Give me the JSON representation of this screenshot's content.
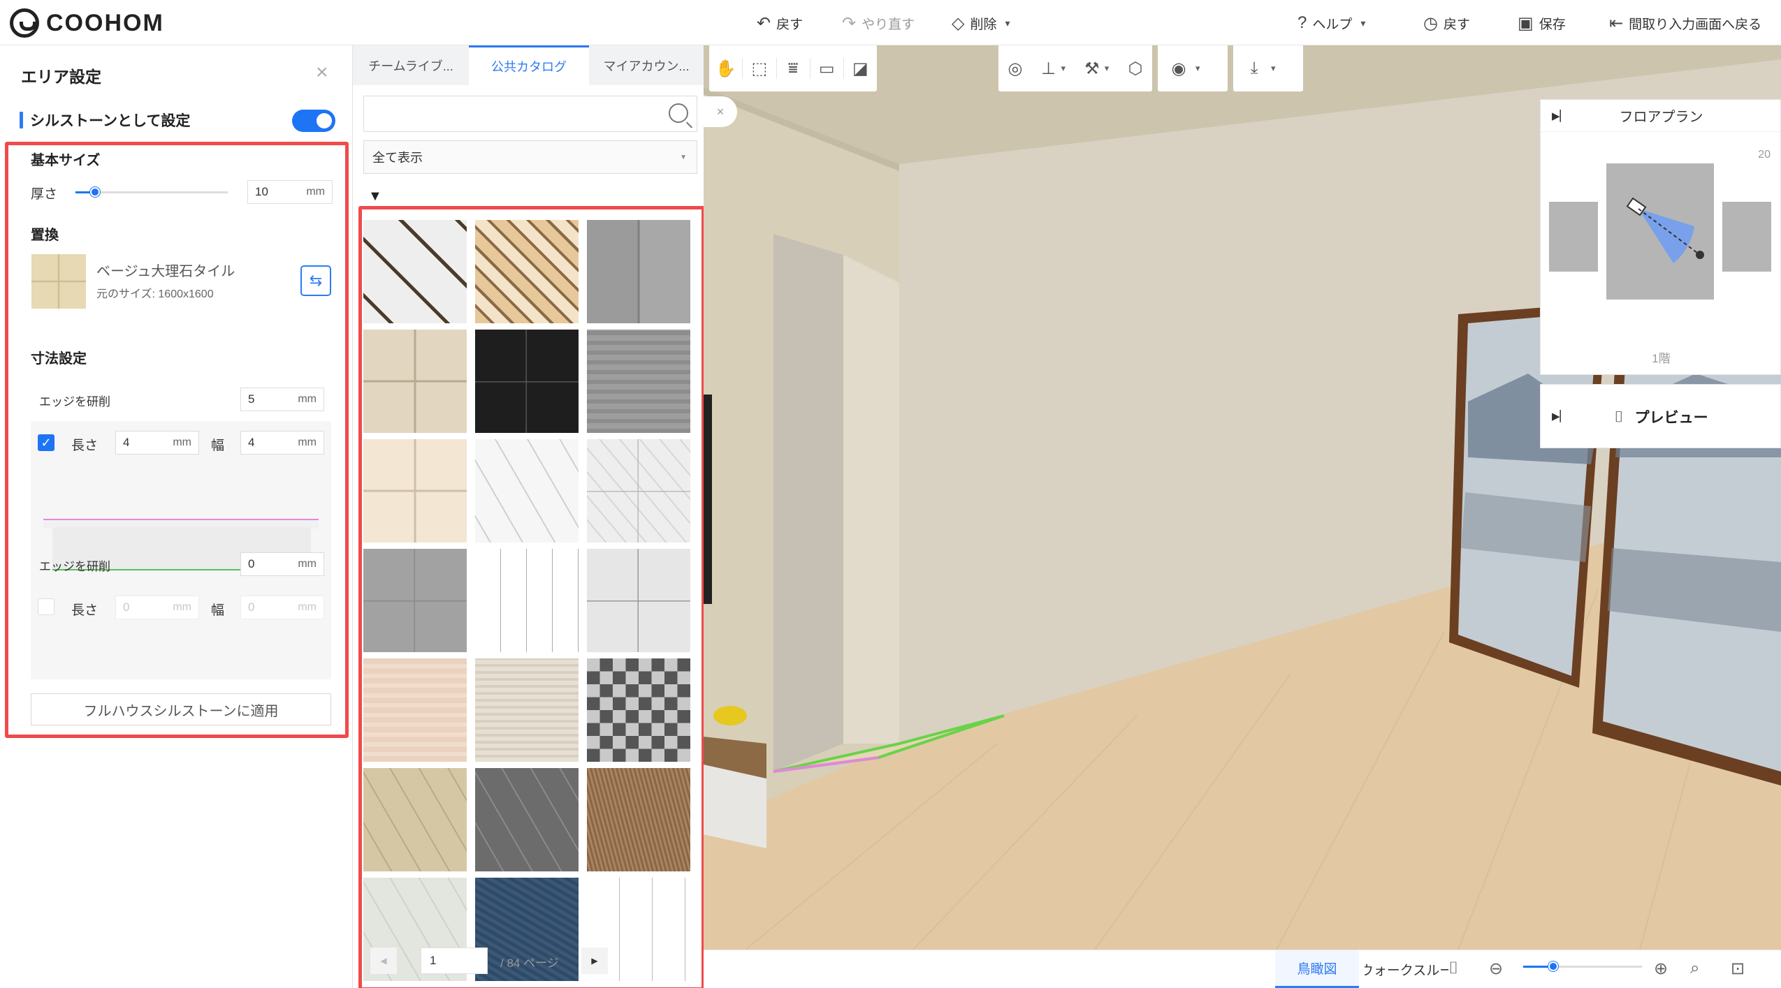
{
  "app": {
    "logo": "COOHOM"
  },
  "toolbar": {
    "undo": "戻す",
    "redo": "やり直す",
    "delete": "削除",
    "help": "ヘルプ",
    "history": "戻す",
    "save": "保存",
    "back_to_floorplan": "間取り入力画面へ戻る"
  },
  "left_panel": {
    "title": "エリア設定",
    "sill_toggle_label": "シルストーンとして設定",
    "sill_toggle_on": true,
    "basic_size": "基本サイズ",
    "thickness_label": "厚さ",
    "thickness_value": "10",
    "thickness_slider_fraction": 0.13,
    "unit": "mm",
    "replace_label": "置換",
    "material_name": "ベージュ大理石タイル",
    "material_size": "元のサイズ: 1600x1600",
    "dimension_settings": "寸法設定",
    "edge1_label": "エッジを研削",
    "edge1_value": "5",
    "edge1_checked": true,
    "length_label": "長さ",
    "width_label": "幅",
    "edge1_length": "4",
    "edge1_width": "4",
    "edge2_label": "エッジを研削",
    "edge2_value": "0",
    "edge2_checked": false,
    "edge2_length": "0",
    "edge2_width": "0",
    "apply_button": "フルハウスシルストーンに適用"
  },
  "catalog": {
    "tabs": [
      "チームライブ...",
      "公共カタログ",
      "マイアカウン..."
    ],
    "active_tab": 1,
    "search_placeholder": "",
    "filter_value": "全て表示",
    "tiles": [
      "diamond-lattice-white-marble",
      "beige-diamond-pattern",
      "grey-patchwork-stone",
      "beige-travertine-4-tile",
      "black-granite",
      "grey-slate-stone",
      "cream-marble-4-tile",
      "white-calacatta-marble",
      "white-veined-marble",
      "grey-stone-2-tile",
      "white-square-grid",
      "light-grey-marble",
      "pink-travertine",
      "cream-travertine",
      "cube-star-pattern",
      "beige-hexagon",
      "grey-hexagon",
      "brown-grass-texture",
      "white-hexagon",
      "blue-granite",
      "white-rect-tile"
    ],
    "page_current": "1",
    "page_total": "/ 84 ページ"
  },
  "viewport": {
    "floorplan_title": "フロアプラン",
    "floorplan_scale": "20",
    "floor_label": "1階",
    "preview_label": "プレビュー"
  },
  "bottom_bar": {
    "view_birdseye": "鳥瞰図",
    "view_walkthrough": "ウォークスルー",
    "zoom_fraction": 0.25
  },
  "colors": {
    "accent": "#1d74f5",
    "highlight_box": "#ef4b4b"
  }
}
